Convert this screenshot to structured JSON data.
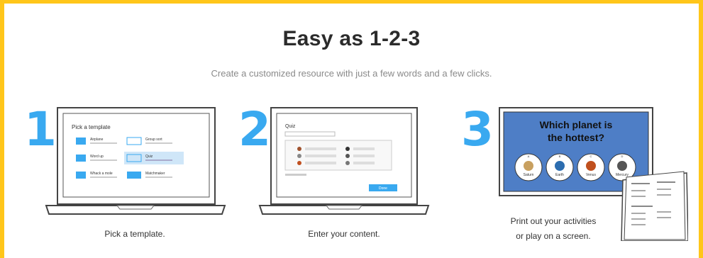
{
  "section": {
    "title": "Easy as 1-2-3",
    "subtitle": "Create a customized resource with just a few words and a few clicks."
  },
  "steps": [
    {
      "number": "1",
      "caption": "Pick a template.",
      "screen": {
        "heading": "Pick a template",
        "templates": [
          "Airplane",
          "Word up",
          "Whack a mole",
          "Group sort",
          "Quiz",
          "Matchmaker"
        ]
      }
    },
    {
      "number": "2",
      "caption": "Enter your content.",
      "screen": {
        "heading": "Quiz",
        "button": "Done"
      }
    },
    {
      "number": "3",
      "caption_line1": "Print out your activities",
      "caption_line2": "or play on a screen.",
      "screen": {
        "question_line1": "Which planet is",
        "question_line2": "the hottest?",
        "answers": [
          "Saturn",
          "Earth",
          "Venus",
          "Mercury"
        ],
        "letters": [
          "A",
          "B",
          "C",
          "D"
        ]
      }
    }
  ],
  "colors": {
    "accent_yellow": "#ffc61a",
    "number_blue": "#39a9f0",
    "quiz_blue": "#4e7ec6"
  }
}
